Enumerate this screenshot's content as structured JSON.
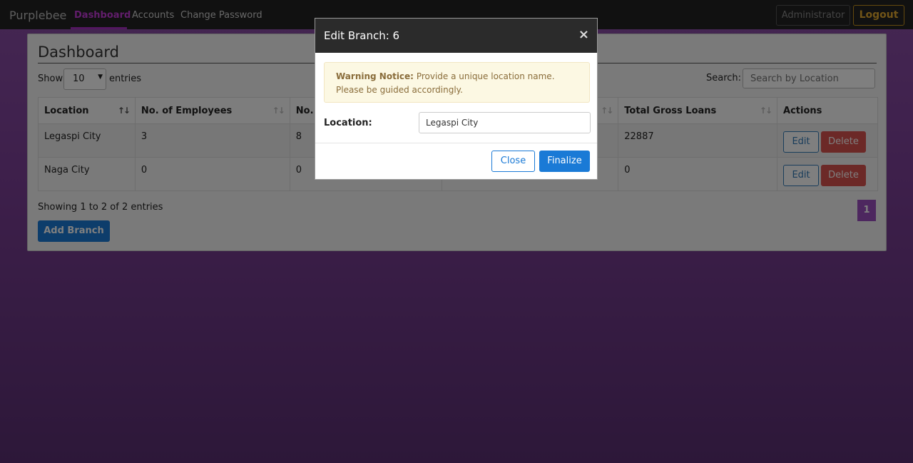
{
  "nav": {
    "brand": "Purplebee",
    "links": [
      {
        "label": "Dashboard"
      },
      {
        "label": "Accounts"
      },
      {
        "label": "Change Password"
      }
    ],
    "admin_label": "Administrator",
    "logout_label": "Logout"
  },
  "panel": {
    "title": "Dashboard",
    "show_label": "Show",
    "page_length": "10",
    "entries_label": "entries",
    "search_label": "Search:",
    "search_placeholder": "Search by Location",
    "info": "Showing 1 to 2 of 2 entries",
    "page": "1",
    "add_label": "Add Branch"
  },
  "table": {
    "headers": [
      "Location",
      "No. of Employees",
      "No.",
      "",
      "Total Gross Loans",
      "Actions"
    ],
    "rows": [
      {
        "location": "Legaspi City",
        "employees": "3",
        "col3": "8",
        "col4": "",
        "gross": "22887"
      },
      {
        "location": "Naga City",
        "employees": "0",
        "col3": "0",
        "col4": "",
        "gross": "0"
      }
    ],
    "edit_label": "Edit",
    "delete_label": "Delete"
  },
  "modal": {
    "title": "Edit Branch: 6",
    "close_glyph": "×",
    "warning_title": "Warning Notice:",
    "warning_text": "Provide a unique location name. Please be guided accordingly.",
    "location_label": "Location:",
    "location_value": "Legaspi City",
    "close_label": "Close",
    "finalize_label": "Finalize"
  },
  "colors": {
    "accent_purple": "#9b4fbf",
    "primary_blue": "#1a7ad6",
    "danger_red": "#d9534f",
    "logout_gold": "#e2a92f"
  }
}
